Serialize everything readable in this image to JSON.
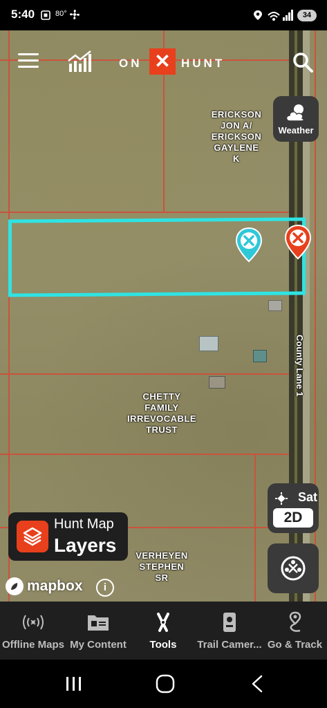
{
  "status_bar": {
    "time": "5:40",
    "temperature": "80°",
    "battery": "34"
  },
  "header": {
    "brand_left": "ON",
    "brand_mark": "✕",
    "brand_right": "HUNT"
  },
  "map": {
    "owner_labels": [
      {
        "text": "ERICKSON\nJON A/\nERICKSON\nGAYLENE\nK"
      },
      {
        "text": "CHETTY\nFAMILY\nIRREVOCABLE\nTRUST"
      },
      {
        "text": "VERHEYEN\nSTEPHEN\nSR"
      }
    ],
    "road_label": "County Lane 1",
    "selection_color": "#2fe3e3",
    "parcel_line_color": "#c9533c",
    "waypoint_colors": {
      "cyan": "#2fc8d8",
      "red": "#e8401c"
    }
  },
  "controls": {
    "weather_label": "Weather",
    "basemap_label": "Sat",
    "view_mode": "2D",
    "layers_line1": "Hunt Map",
    "layers_line2": "Layers",
    "attribution": "mapbox",
    "info_symbol": "i"
  },
  "bottom_nav": [
    {
      "label": "Offline Maps",
      "icon": "offline-signal-icon"
    },
    {
      "label": "My Content",
      "icon": "folder-icon"
    },
    {
      "label": "Tools",
      "icon": "tools-icon",
      "active": true
    },
    {
      "label": "Trail Camer...",
      "icon": "trail-camera-icon"
    },
    {
      "label": "Go & Track",
      "icon": "route-pin-icon"
    }
  ],
  "accent_color": "#e8401c"
}
